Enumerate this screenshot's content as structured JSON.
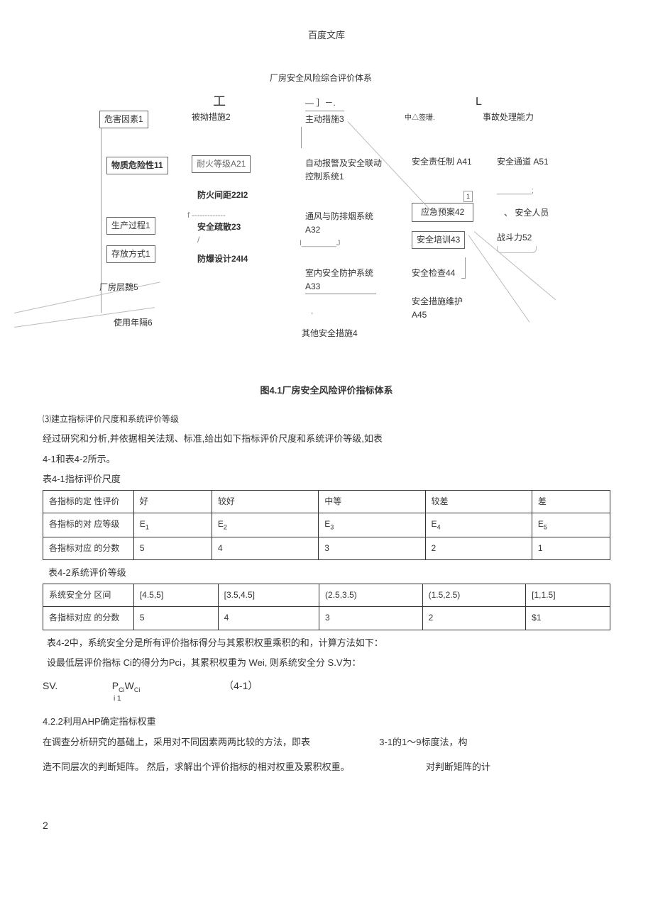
{
  "header": "百度文库",
  "diagram": {
    "root": "厂房安全风险综合评价体系",
    "marks": {
      "gong": "工",
      "yi": "— ］－.",
      "L": "L"
    },
    "col1": {
      "title": "危害因素1",
      "items": [
        "物质危险性11",
        "生产过程1",
        "存放方式1",
        "厂房层魏5",
        "使用年隔6"
      ]
    },
    "col2": {
      "title": "被动措施2",
      "overlap": "被拗措施2",
      "items": [
        "耐火等级A21",
        "防火间距22I2",
        "安全疏散23",
        "防爆设计24I4"
      ],
      "extra_marks": [
        "f -------------",
        "/"
      ]
    },
    "col3": {
      "title": "主动措施3",
      "items": [
        "自动报警及安全联动控制系统1",
        "通风与防排烟系统A32",
        "室内安全防护系统A33",
        "其他安全措施4"
      ],
      "marks": [
        "I________J",
        ","
      ]
    },
    "col4": {
      "title": "安全管理",
      "title_frag": "中△签珊.",
      "items": [
        "安全责任制 A41",
        "应急预案42",
        "安全培训43",
        "安全检查44",
        "安全措施维护A45"
      ],
      "num": "1"
    },
    "col5": {
      "title": "事故处理能力",
      "items": [
        "安全通道 A51",
        "、 安全人员",
        "战斗力52"
      ],
      "mark": "________;"
    }
  },
  "diagram_title": "图4.1厂房安全风险评价指标体系",
  "section3_heading": "⑶建立指标评价尺度和系统评价等级",
  "section3_p1": "经过研究和分析,并依据相关法规、标准,给出如下指标评价尺度和系统评价等级,如表",
  "section3_p2": "4-1和表4-2所示。",
  "table1_title": "表4-1指标评价尺度",
  "table1": {
    "r1": [
      "各指标的定 性评价",
      "好",
      "较好",
      "中等",
      "较差",
      "差"
    ],
    "r2": [
      "各指标的对 应等级",
      "E1",
      "E2",
      "E3",
      "E4",
      "E5"
    ],
    "r3": [
      "各指标对应 的分数",
      "5",
      "4",
      "3",
      "2",
      "1"
    ]
  },
  "table2_title": "表4-2系统评价等级",
  "table2": {
    "r1": [
      "系统安全分 区间",
      "[4.5,5]",
      "[3.5,4.5]",
      "(2.5,3.5)",
      "(1.5,2.5)",
      "[1,1.5]"
    ],
    "r2": [
      "各指标对应 的分数",
      "5",
      "4",
      "3",
      "2",
      "$1"
    ]
  },
  "after_t2_p1": "表4-2中，系统安全分是所有评价指标得分与其累积权重乘积的和，计算方法如下：",
  "after_t2_p2": "设最低层评价指标 Ci的得分为Pci，其累积权重为 Wei, 则系统安全分 S.V为：",
  "formula": {
    "lhs": "SV.",
    "mid": "PCi",
    "mid2": "WCi",
    "sub": "i 1",
    "eqnum": "（4-1）"
  },
  "heading422": "4.2.2利用AHP确定指标权重",
  "p422_1a": "在调查分析研究的基础上，采用对不同因素两两比较的方法，即表",
  "p422_1b": "3-1的1～9标度法，构",
  "p422_2a": "造不同层次的判断矩阵。 然后，求解出个评价指标的相对权重及累积权重。",
  "p422_2b": "对判断矩阵的计",
  "page_num": "2"
}
